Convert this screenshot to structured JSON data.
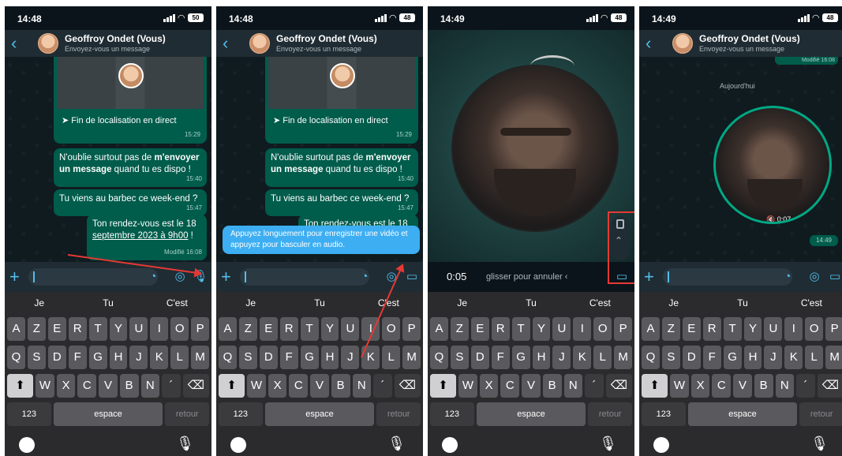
{
  "screens": [
    {
      "time": "14:48",
      "battery": "50",
      "contact": "Geoffroy Ondet (Vous)",
      "subtitle": "Envoyez-vous un message",
      "location_text": "Fin de localisation en direct",
      "location_time": "15:29",
      "msg1_a": "N'oublie surtout pas de ",
      "msg1_b": "m'envoyer un message",
      "msg1_c": " quand tu es dispo !",
      "msg1_time": "15:40",
      "msg2": "Tu viens au barbec ce week-end ?",
      "msg2_time": "15:47",
      "msg3_a": "Ton rendez-vous est le 18 ",
      "msg3_b": "septembre 2023 à 9h00",
      "msg3_c": " !",
      "msg3_time": "Modifié 16:08"
    },
    {
      "time": "14:48",
      "battery": "48",
      "contact": "Geoffroy Ondet (Vous)",
      "subtitle": "Envoyez-vous un message",
      "location_text": "Fin de localisation en direct",
      "location_time": "15:29",
      "msg1_a": "N'oublie surtout pas de ",
      "msg1_b": "m'envoyer un message",
      "msg1_c": " quand tu es dispo !",
      "msg1_time": "15:40",
      "msg2": "Tu viens au barbec ce week-end ?",
      "msg2_time": "15:47",
      "msg3": "Ton rendez-vous est le 18",
      "tooltip": "Appuyez longuement pour enregistrer une vidéo et appuyez pour basculer en audio."
    },
    {
      "time": "14:49",
      "battery": "48",
      "rec_time": "0:05",
      "slide_text": "glisser pour annuler"
    },
    {
      "time": "14:49",
      "battery": "48",
      "contact": "Geoffroy Ondet (Vous)",
      "subtitle": "Envoyez-vous un message",
      "top_time": "Modifié 16:08",
      "today": "Aujourd'hui",
      "video_duration": "0:07",
      "video_time": "14:49"
    }
  ],
  "keyboard": {
    "suggestions": [
      "Je",
      "Tu",
      "C'est"
    ],
    "row1": [
      "A",
      "Z",
      "E",
      "R",
      "T",
      "Y",
      "U",
      "I",
      "O",
      "P"
    ],
    "row2": [
      "Q",
      "S",
      "D",
      "F",
      "G",
      "H",
      "J",
      "K",
      "L",
      "M"
    ],
    "row3": [
      "W",
      "X",
      "C",
      "V",
      "B",
      "N",
      "´"
    ],
    "key_123": "123",
    "key_space": "espace",
    "key_return": "retour"
  },
  "colors": {
    "accent": "#53bdeb",
    "bubble": "#005c4b",
    "annotation": "#e53935"
  }
}
